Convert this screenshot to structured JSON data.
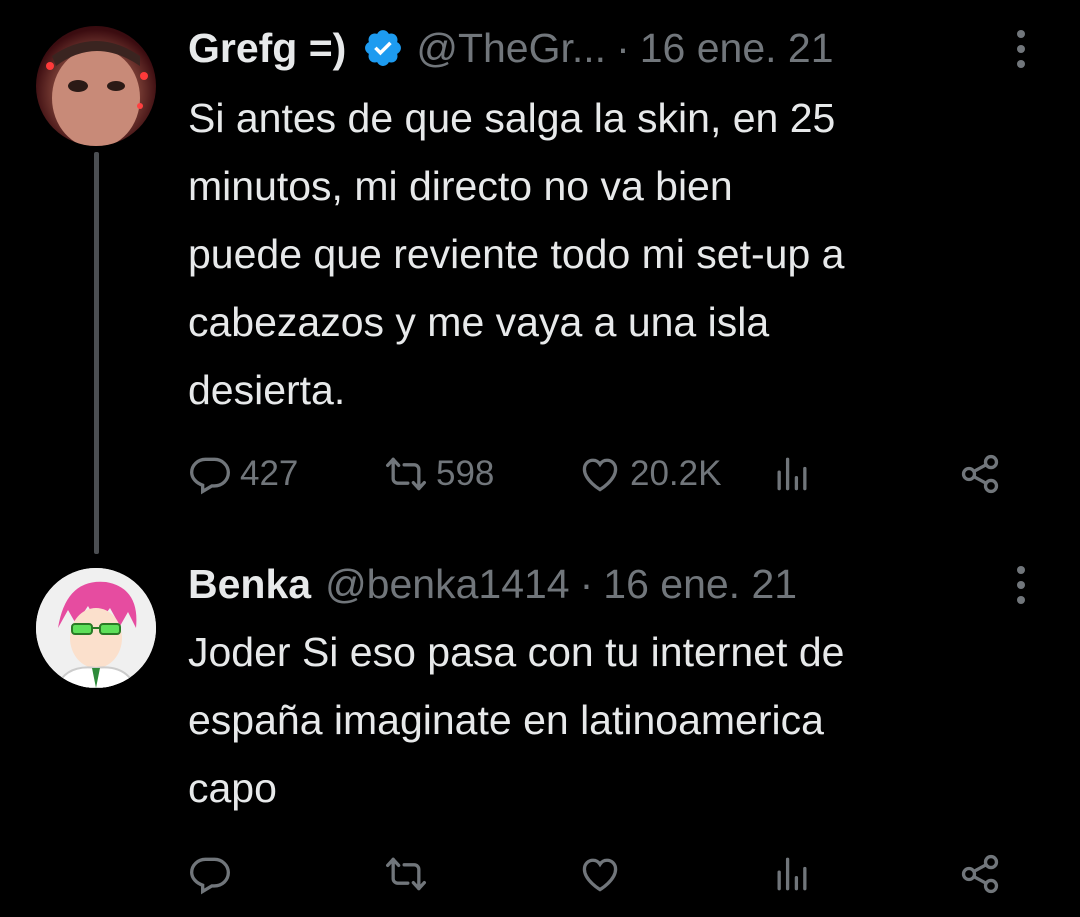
{
  "tweets": [
    {
      "author": {
        "display_name": "Grefg =)",
        "handle": "@TheGr...",
        "verified": true,
        "avatar_icon": "user-avatar"
      },
      "separator": "·",
      "date": "16 ene. 21",
      "text": "Si antes de que salga la skin, en 25\nminutos, mi directo no va bien\npuede que reviente todo mi set-up a\ncabezazos y me vaya a una isla\ndesierta.",
      "metrics": {
        "replies": "427",
        "retweets": "598",
        "likes": "20.2K",
        "views": ""
      }
    },
    {
      "author": {
        "display_name": "Benka",
        "handle": "@benka1414",
        "verified": false,
        "avatar_icon": "anime-avatar"
      },
      "separator": "·",
      "date": "16 ene. 21",
      "text": "Joder Si eso pasa con tu internet de\nespaña imaginate en latinoamerica\ncapo",
      "metrics": {
        "replies": "",
        "retweets": "",
        "likes": "",
        "views": ""
      }
    }
  ],
  "colors": {
    "background": "#000000",
    "text_primary": "#e7e9ea",
    "text_secondary": "#71767b",
    "verified_badge": "#1d9bf0",
    "thread_line": "#4b4e52"
  }
}
